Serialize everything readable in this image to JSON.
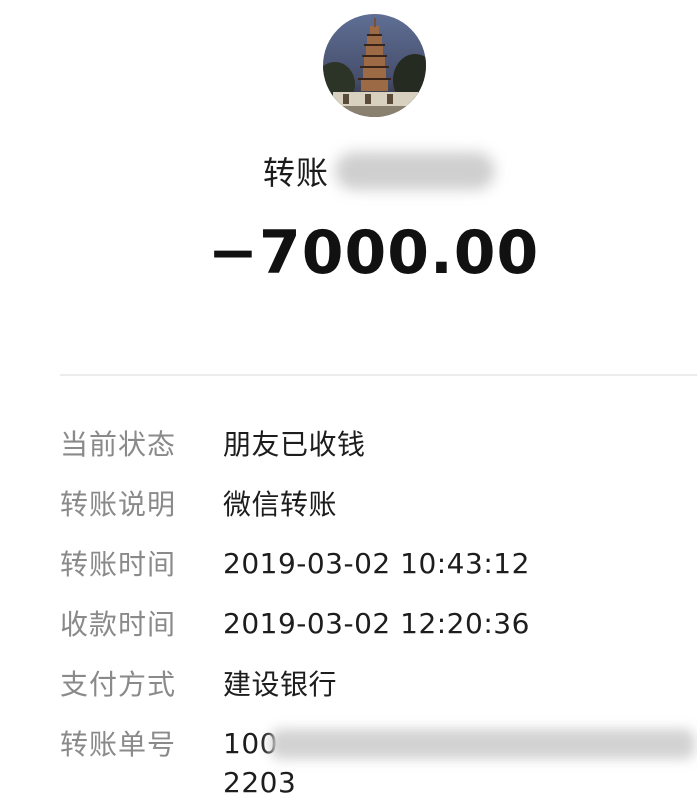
{
  "header": {
    "avatar": "pagoda-avatar-icon",
    "title": "转账",
    "amount": "−7000.00"
  },
  "details": [
    {
      "label": "当前状态",
      "value": "朋友已收钱"
    },
    {
      "label": "转账说明",
      "value": "微信转账"
    },
    {
      "label": "转账时间",
      "value": "2019-03-02 10:43:12"
    },
    {
      "label": "收款时间",
      "value": "2019-03-02 12:20:36"
    },
    {
      "label": "支付方式",
      "value": "建设银行"
    },
    {
      "label": "转账单号",
      "value": "100",
      "value_line2": "2203"
    }
  ]
}
